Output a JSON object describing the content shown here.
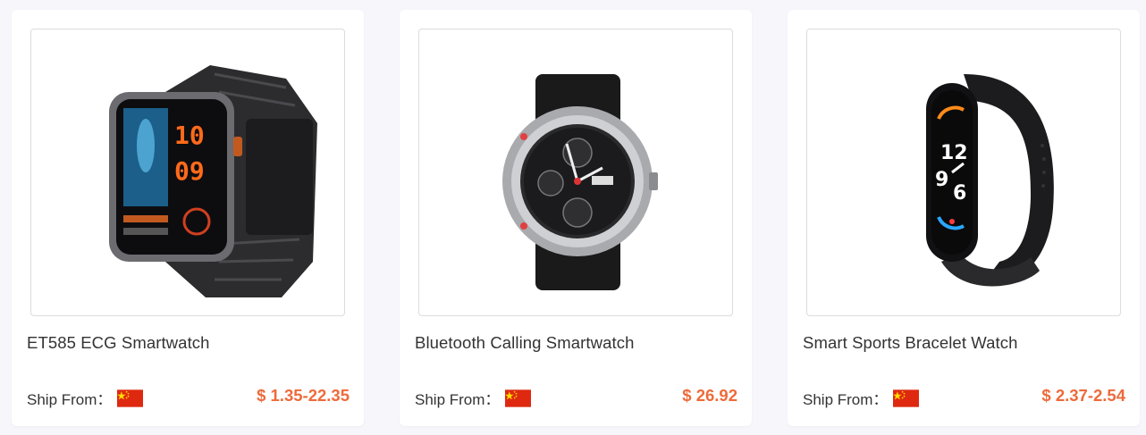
{
  "products": [
    {
      "title": "ET585 ECG Smartwatch",
      "ship_label": "Ship From：",
      "flag_icon": "china-flag-icon",
      "price": "$ 1.35-22.35",
      "image_icon": "et585-ecg-smartwatch-image"
    },
    {
      "title": "Bluetooth Calling Smartwatch",
      "ship_label": "Ship From：",
      "flag_icon": "china-flag-icon",
      "price": "$ 26.92",
      "image_icon": "round-bluetooth-smartwatch-image"
    },
    {
      "title": "Smart Sports Bracelet Watch",
      "ship_label": "Ship From：",
      "flag_icon": "china-flag-icon",
      "price": "$ 2.37-2.54",
      "image_icon": "sports-bracelet-watch-image"
    }
  ],
  "colors": {
    "price": "#ee6a3a",
    "flag_red": "#de2910",
    "flag_star": "#ffde00",
    "background": "#f7f7fb"
  }
}
